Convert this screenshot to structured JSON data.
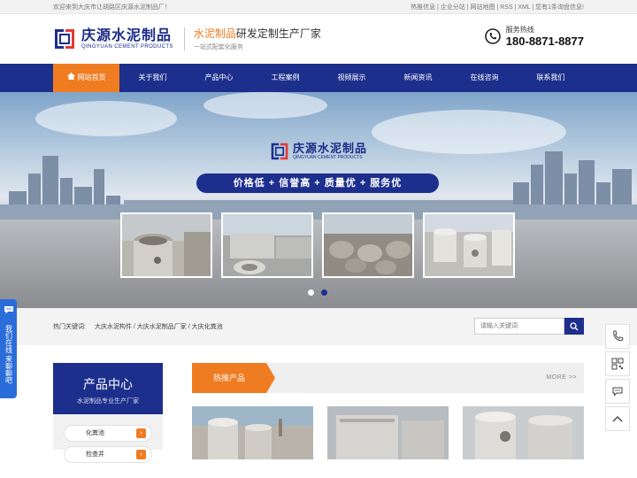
{
  "topbar": {
    "welcome": "欢迎来到大庆市让胡路区庆源水泥制品厂！",
    "links": "热推信息 | 企业分站 | 网站地图 | RSS | XML | 您有1条询盘信息!"
  },
  "header": {
    "logo_cn": "庆源水泥制品",
    "logo_en": "QINGYUAN CEMENT PRODUCTS",
    "slogan_accent": "水泥制品",
    "slogan_rest": "研发定制生产厂家",
    "slogan_sub": "一站式配套化服务",
    "phone_label": "服务热线",
    "phone_number": "180-8871-8877"
  },
  "nav": {
    "items": [
      "网站首页",
      "关于我们",
      "产品中心",
      "工程案例",
      "视频展示",
      "新闻资讯",
      "在线咨询",
      "联系我们"
    ]
  },
  "banner": {
    "logo_cn": "庆源水泥制品",
    "logo_en": "QINGYUAN CEMENT PRODUCTS",
    "slogan": "价格低 + 信誉高 + 质量优 + 服务优"
  },
  "keywords": {
    "label": "热门关键词:",
    "links": "大庆水泥构件 / 大庆水泥制品厂家 / 大庆化粪池"
  },
  "search": {
    "placeholder": "请输入关键词"
  },
  "sidebar": {
    "title": "产品中心",
    "subtitle": "水泥制品专业生产厂家",
    "items": [
      "化粪池",
      "检查井"
    ]
  },
  "hot": {
    "tab": "热推产品",
    "more": "MORE >>"
  },
  "float_left": {
    "label": "我们在线 来聊聊吧"
  },
  "icons": [
    "phone-icon",
    "qrcode-icon",
    "chat-icon",
    "up-arrow-icon",
    "search-icon",
    "home-icon"
  ],
  "colors": {
    "brand_blue": "#1d2f8c",
    "accent_orange": "#f07c22"
  }
}
